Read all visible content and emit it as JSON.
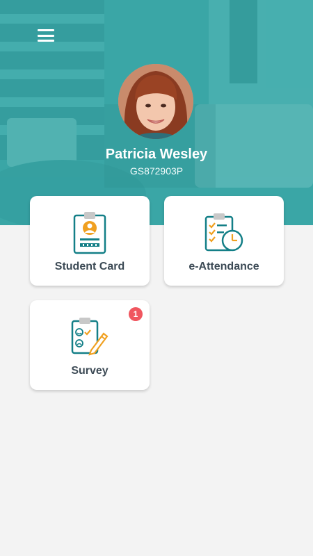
{
  "profile": {
    "name": "Patricia Wesley",
    "student_id": "GS872903P"
  },
  "menu": {
    "icon": "hamburger-menu-icon"
  },
  "cards": [
    {
      "label": "Student Card",
      "icon": "student-card-icon"
    },
    {
      "label": "e-Attendance",
      "icon": "attendance-icon"
    },
    {
      "label": "Survey",
      "icon": "survey-icon",
      "badge": "1"
    }
  ],
  "colors": {
    "hero": "#3aa6a6",
    "accent_teal": "#137f87",
    "accent_orange": "#f0a020",
    "badge": "#f0565f",
    "text": "#3c4a55"
  }
}
